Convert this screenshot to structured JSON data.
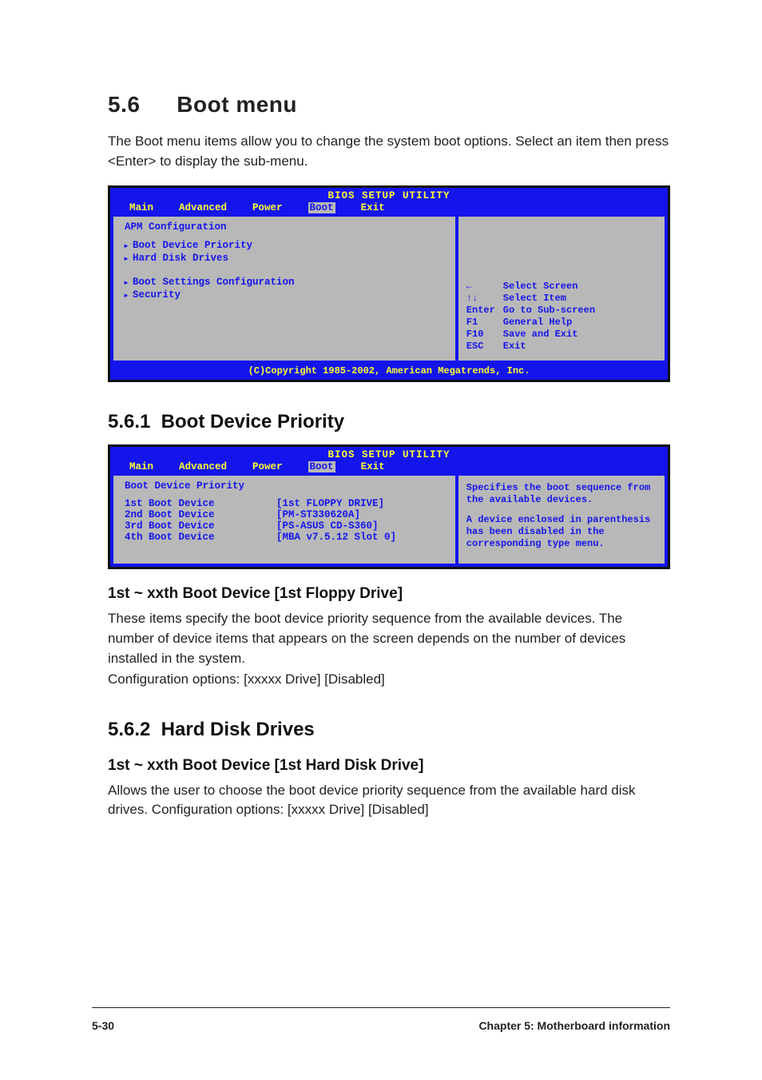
{
  "section": {
    "number": "5.6",
    "title": "Boot menu"
  },
  "intro": "The Boot menu items allow you to change the system boot options. Select an item then press <Enter> to display the sub-menu.",
  "bios1": {
    "utility_title": "BIOS SETUP UTILITY",
    "menu": [
      "Main",
      "Advanced",
      "Power",
      "Boot",
      "Exit"
    ],
    "left_heading": "APM Configuration",
    "items_group1": [
      "Boot Device Priority",
      "Hard Disk Drives"
    ],
    "items_group2": [
      "Boot Settings Configuration",
      "Security"
    ],
    "keyhelp": [
      {
        "key": "←",
        "label": "Select Screen"
      },
      {
        "key": "↑↓",
        "label": "Select Item"
      },
      {
        "key": "Enter",
        "label": "Go to Sub-screen"
      },
      {
        "key": "F1",
        "label": "General Help"
      },
      {
        "key": "F10",
        "label": "Save and Exit"
      },
      {
        "key": "ESC",
        "label": "Exit"
      }
    ],
    "footer": "(C)Copyright 1985-2002, American Megatrends, Inc."
  },
  "sub1": {
    "number": "5.6.1",
    "title": "Boot Device Priority"
  },
  "bios2": {
    "utility_title": "BIOS SETUP UTILITY",
    "menu": [
      "Main",
      "Advanced",
      "Power",
      "Boot",
      "Exit"
    ],
    "left_heading": "Boot Device Priority",
    "devices": [
      {
        "label": "1st Boot Device",
        "value": "[1st FLOPPY DRIVE]"
      },
      {
        "label": "2nd Boot Device",
        "value": "[PM-ST330620A]"
      },
      {
        "label": "3rd Boot Device",
        "value": "[PS-ASUS CD-S360]"
      },
      {
        "label": "4th Boot Device",
        "value": "[MBA v7.5.12 Slot 0]"
      }
    ],
    "right_text1": "Specifies the boot sequence from the available devices.",
    "right_text2": "A device enclosed in parenthesis has been disabled in the corresponding type menu."
  },
  "option1": {
    "title": "1st ~ xxth Boot Device [1st Floppy Drive]",
    "para": "These items specify the boot device priority sequence from the available devices. The number of device items that appears on the screen depends on the number of devices installed in the system.",
    "config": "Configuration options: [xxxxx Drive] [Disabled]"
  },
  "sub2": {
    "number": "5.6.2",
    "title": "Hard Disk Drives"
  },
  "option2": {
    "title": "1st ~ xxth Boot Device [1st Hard Disk Drive]",
    "para": "Allows the user to choose the boot device priority sequence from the available hard disk drives. Configuration options: [xxxxx Drive] [Disabled]"
  },
  "footer": {
    "page": "5-30",
    "chapter": "Chapter 5: Motherboard information"
  }
}
